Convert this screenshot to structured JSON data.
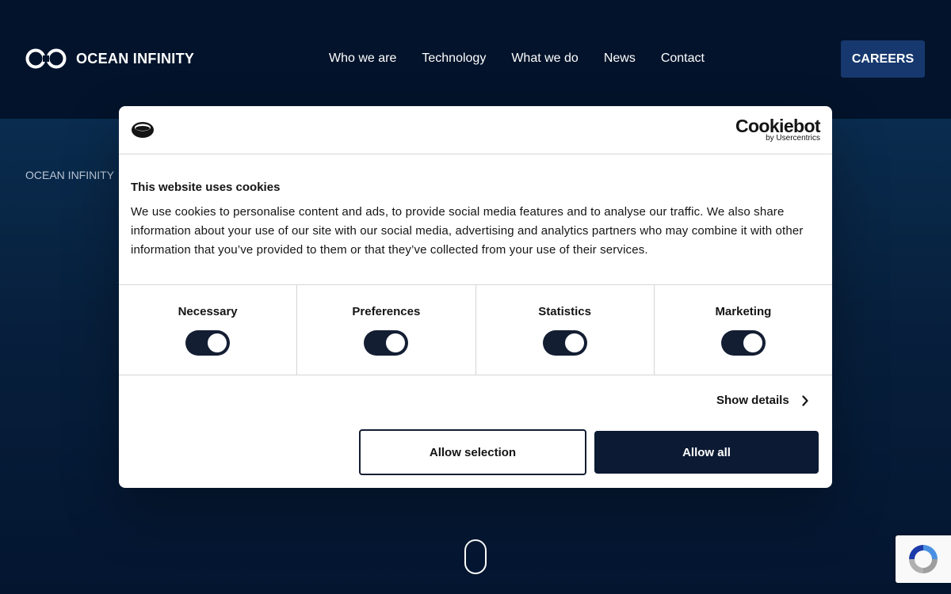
{
  "header": {
    "brand": "OCEAN INFINITY",
    "nav": [
      "Who we are",
      "Technology",
      "What we do",
      "News",
      "Contact"
    ],
    "cta": "CAREERS"
  },
  "hero": {
    "breadcrumb": "OCEAN INFINITY"
  },
  "cookie_dialog": {
    "brand_main": "Cookiebot",
    "brand_sub": "by Usercentrics",
    "title": "This website uses cookies",
    "body": "We use cookies to personalise content and ads, to provide social media features and to analyse our traffic. We also share information about your use of our site with our social media, advertising and analytics partners who may combine it with other information that you’ve provided to them or that they’ve collected from your use of their services.",
    "categories": [
      {
        "label": "Necessary",
        "enabled": true
      },
      {
        "label": "Preferences",
        "enabled": true
      },
      {
        "label": "Statistics",
        "enabled": true
      },
      {
        "label": "Marketing",
        "enabled": true
      }
    ],
    "show_details": "Show details",
    "allow_selection": "Allow selection",
    "allow_all": "Allow all"
  },
  "icons": [
    "infinity-logo-icon",
    "cookiebot-logo-icon",
    "chevron-right-icon",
    "scroll-indicator-icon",
    "recaptcha-icon"
  ],
  "colors": {
    "header_bg": "#02132b",
    "hero_bg": "#07203d",
    "careers_bg": "#16386e",
    "toggle_on": "#141e33",
    "allow_all_bg": "#0c1a33"
  }
}
